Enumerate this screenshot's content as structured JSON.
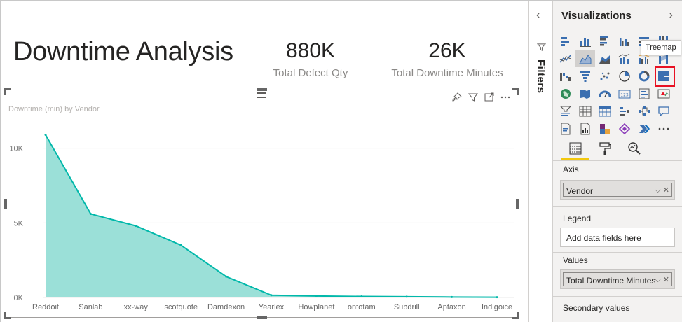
{
  "report": {
    "title": "Downtime Analysis",
    "cards": [
      {
        "value": "880K",
        "label": "Total Defect Qty"
      },
      {
        "value": "26K",
        "label": "Total Downtime Minutes"
      }
    ]
  },
  "visual": {
    "toolbar_icons": [
      "pin-icon",
      "filter-icon",
      "focus-mode-icon",
      "more-options-icon"
    ]
  },
  "chart_data": {
    "type": "area",
    "title": "Downtime (min) by Vendor",
    "xlabel": "",
    "ylabel": "",
    "categories": [
      "Reddoit",
      "Sanlab",
      "xx-way",
      "scotquote",
      "Damdexon",
      "Yearlex",
      "Howplanet",
      "ontotam",
      "Subdrill",
      "Aptaxon",
      "Indigoice"
    ],
    "values": [
      10900,
      5600,
      4800,
      3500,
      1400,
      150,
      100,
      70,
      50,
      30,
      20
    ],
    "yticks": [
      "0K",
      "5K",
      "10K"
    ],
    "ylim": [
      0,
      12000
    ],
    "grid": true,
    "color": "#01B8AA",
    "fill": "#9BE0D8"
  },
  "filters_pane": {
    "label": "Filters"
  },
  "viz_pane": {
    "title": "Visualizations",
    "tooltip": "Treemap",
    "selected_icon": "treemap-icon",
    "wells": {
      "axis": {
        "label": "Axis",
        "value": "Vendor"
      },
      "legend": {
        "label": "Legend",
        "placeholder": "Add data fields here"
      },
      "values": {
        "label": "Values",
        "value": "Total Downtime Minutes"
      },
      "secondary": {
        "label": "Secondary values"
      }
    }
  }
}
